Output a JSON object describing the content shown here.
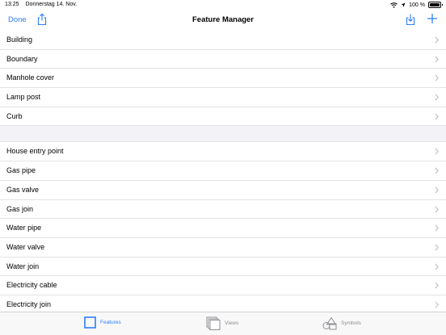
{
  "status_bar": {
    "time": "13:25",
    "date": "Donnerstag 14. Nov.",
    "battery": "100 %"
  },
  "nav": {
    "done_label": "Done",
    "title": "Feature Manager"
  },
  "features_group_1": [
    {
      "label": "Building"
    },
    {
      "label": "Boundary"
    },
    {
      "label": "Manhole cover"
    },
    {
      "label": "Lamp post"
    },
    {
      "label": "Curb"
    }
  ],
  "features_group_2": [
    {
      "label": "House entry point"
    },
    {
      "label": "Gas pipe"
    },
    {
      "label": "Gas valve"
    },
    {
      "label": "Gas join"
    },
    {
      "label": "Water pipe"
    },
    {
      "label": "Water valve"
    },
    {
      "label": "Water join"
    },
    {
      "label": "Electricity cable"
    },
    {
      "label": "Electricity join"
    }
  ],
  "tabs": [
    {
      "label": "Features",
      "icon": "square-icon",
      "active": true
    },
    {
      "label": "Views",
      "icon": "stacked-pages-icon",
      "active": false
    },
    {
      "label": "Symbols",
      "icon": "shapes-icon",
      "active": false
    }
  ],
  "colors": {
    "accent": "#2f7ef6",
    "separator": "#e3e3e6",
    "section_background": "#f2f2f7",
    "inactive_tab": "#8e8e93"
  }
}
